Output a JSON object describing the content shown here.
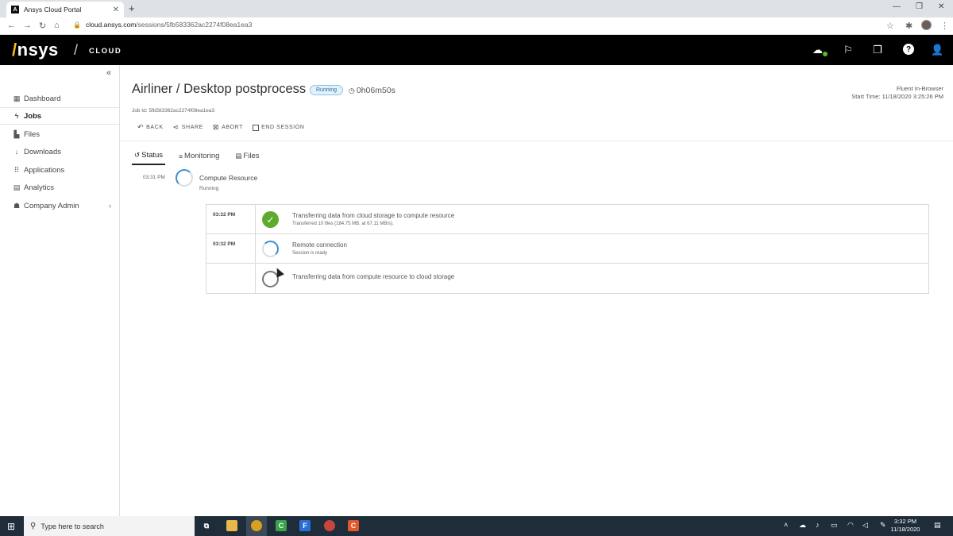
{
  "browser": {
    "tab_title": "Ansys Cloud Portal",
    "tab_close": "✕",
    "new_tab": "+",
    "url_host": "cloud.ansys.com",
    "url_path": "/sessions/5fb583362ac2274f08ea1ea3"
  },
  "header": {
    "logo_prefix": "/",
    "logo_text": "nsys",
    "separator": "/",
    "product": "CLOUD",
    "help": "?"
  },
  "sidebar": {
    "collapse": "«",
    "items": [
      {
        "label": "Dashboard",
        "icon": "dashboard-icon"
      },
      {
        "label": "Jobs",
        "icon": "bolt-icon"
      },
      {
        "label": "Files",
        "icon": "files-icon"
      },
      {
        "label": "Downloads",
        "icon": "download-icon"
      },
      {
        "label": "Applications",
        "icon": "grid-icon"
      },
      {
        "label": "Analytics",
        "icon": "chart-icon"
      },
      {
        "label": "Company Admin",
        "icon": "users-icon"
      }
    ]
  },
  "job": {
    "title": "Airliner / Desktop postprocess",
    "status": "Running",
    "elapsed": "0h06m50s",
    "job_id": "Job Id: 5fb583362ac2274f08ea1ea3",
    "app": "Fluent In-Browser",
    "start_time": "Start Time: 11/18/2020 3:25:26 PM"
  },
  "actions": {
    "back": "BACK",
    "share": "SHARE",
    "abort": "ABORT",
    "end_session": "END SESSION"
  },
  "tabs": {
    "status": "Status",
    "monitoring": "Monitoring",
    "files": "Files"
  },
  "timeline": {
    "main_step": {
      "time": "03:31 PM",
      "name": "Compute Resource",
      "state": "Running"
    },
    "substeps": [
      {
        "time": "03:32 PM",
        "title": "Transferring data from cloud storage to compute resource",
        "detail": "Transferred 10 files (184.75 MB, at 67.11 MB/s).",
        "state": "done"
      },
      {
        "time": "03:32 PM",
        "title": "Remote connection",
        "detail": "Session is ready",
        "state": "in-progress"
      },
      {
        "time": "",
        "title": "Transferring data from compute resource to cloud storage",
        "detail": "",
        "state": "pending"
      }
    ]
  },
  "taskbar": {
    "search_placeholder": "Type here to search",
    "time": "3:32 PM",
    "date": "11/18/2020"
  }
}
